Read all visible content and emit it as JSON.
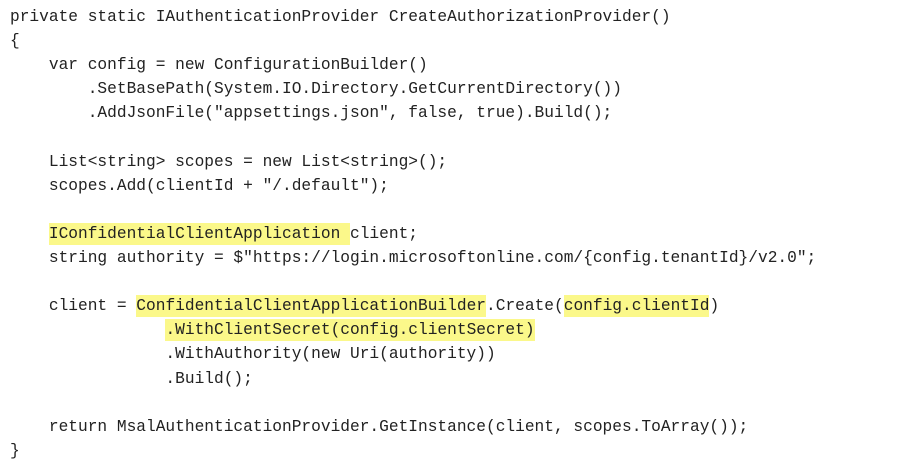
{
  "code": {
    "lines": [
      {
        "segments": [
          {
            "text": "private static IAuthenticationProvider CreateAuthorizationProvider()"
          }
        ]
      },
      {
        "segments": [
          {
            "text": "{"
          }
        ]
      },
      {
        "segments": [
          {
            "text": "    var config = new ConfigurationBuilder()"
          }
        ]
      },
      {
        "segments": [
          {
            "text": "        .SetBasePath(System.IO.Directory.GetCurrentDirectory())"
          }
        ]
      },
      {
        "segments": [
          {
            "text": "        .AddJsonFile(\"appsettings.json\", false, true).Build();"
          }
        ]
      },
      {
        "segments": [
          {
            "text": ""
          }
        ]
      },
      {
        "segments": [
          {
            "text": "    List<string> scopes = new List<string>();"
          }
        ]
      },
      {
        "segments": [
          {
            "text": "    scopes.Add(clientId + \"/.default\");"
          }
        ]
      },
      {
        "segments": [
          {
            "text": ""
          }
        ]
      },
      {
        "segments": [
          {
            "text": "    "
          },
          {
            "text": "IConfidentialClientApplication ",
            "hl": true
          },
          {
            "text": "client;"
          }
        ]
      },
      {
        "segments": [
          {
            "text": "    string authority = $\"https://login.microsoftonline.com/{config.tenantId}/v2.0\";"
          }
        ]
      },
      {
        "segments": [
          {
            "text": ""
          }
        ]
      },
      {
        "segments": [
          {
            "text": "    client = "
          },
          {
            "text": "ConfidentialClientApplicationBuilder",
            "hl": true
          },
          {
            "text": ".Create("
          },
          {
            "text": "config.clientId",
            "hl": true
          },
          {
            "text": ")"
          }
        ]
      },
      {
        "segments": [
          {
            "text": "                "
          },
          {
            "text": ".WithClientSecret(config.clientSecret)",
            "hl": true
          }
        ]
      },
      {
        "segments": [
          {
            "text": "                .WithAuthority(new Uri(authority))"
          }
        ]
      },
      {
        "segments": [
          {
            "text": "                .Build();"
          }
        ]
      },
      {
        "segments": [
          {
            "text": ""
          }
        ]
      },
      {
        "segments": [
          {
            "text": "    return MsalAuthenticationProvider.GetInstance(client, scopes.ToArray());"
          }
        ]
      },
      {
        "segments": [
          {
            "text": "}"
          }
        ]
      }
    ],
    "colors": {
      "background": "#ffffff",
      "text": "#222222",
      "highlight": "#fbf88a"
    }
  }
}
